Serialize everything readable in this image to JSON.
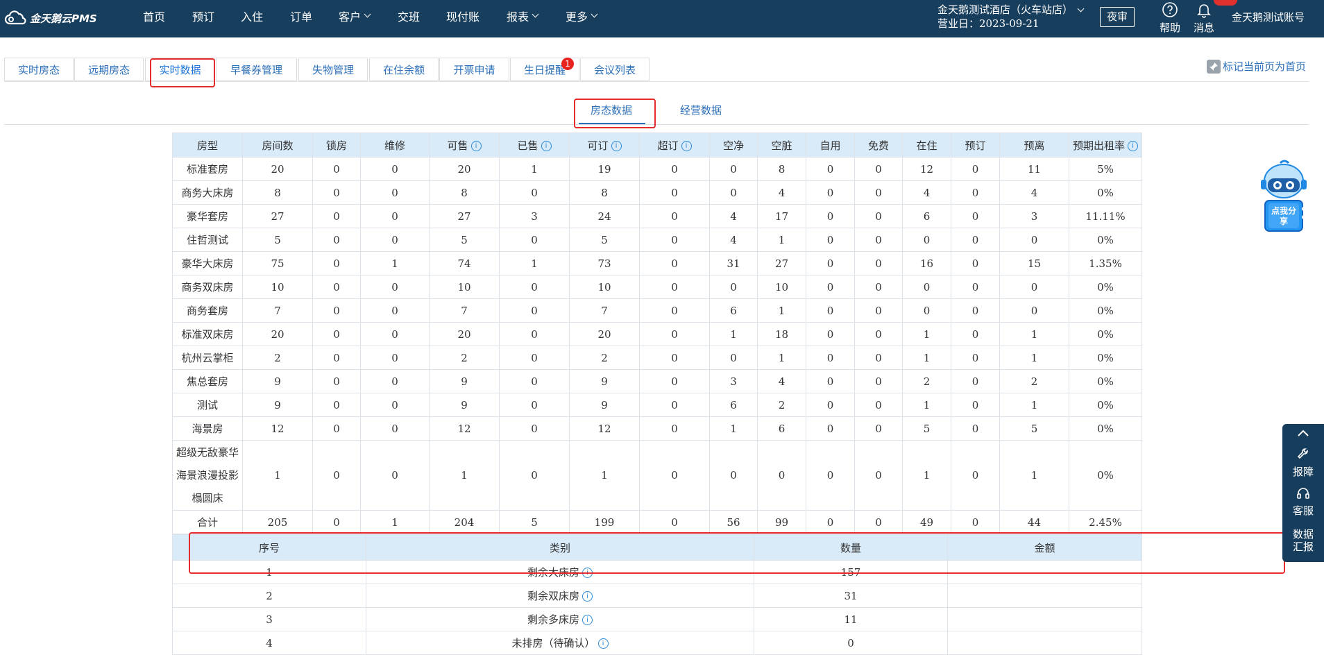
{
  "brand": {
    "name": "金天鹅云PMS"
  },
  "nav": [
    {
      "label": "首页",
      "dropdown": false
    },
    {
      "label": "预订",
      "dropdown": false
    },
    {
      "label": "入住",
      "dropdown": false
    },
    {
      "label": "订单",
      "dropdown": false
    },
    {
      "label": "客户",
      "dropdown": true
    },
    {
      "label": "交班",
      "dropdown": false
    },
    {
      "label": "现付账",
      "dropdown": false
    },
    {
      "label": "报表",
      "dropdown": true
    },
    {
      "label": "更多",
      "dropdown": true
    }
  ],
  "header": {
    "hotel_name": "金天鹅测试酒店（火车站店）",
    "business_date": "营业日：2023-09-21",
    "night_audit": "夜审",
    "help": "帮助",
    "messages": "消息",
    "account": "金天鹅测试账号"
  },
  "tabs": [
    {
      "label": "实时房态"
    },
    {
      "label": "远期房态"
    },
    {
      "label": "实时数据",
      "active": true
    },
    {
      "label": "早餐券管理"
    },
    {
      "label": "失物管理"
    },
    {
      "label": "在住余额"
    },
    {
      "label": "开票申请"
    },
    {
      "label": "生日提醒",
      "badge": "1"
    },
    {
      "label": "会议列表"
    }
  ],
  "pin_home": "标记当前页为首页",
  "subtabs": {
    "room_status": "房态数据",
    "business": "经营数据"
  },
  "room_table": {
    "headers": [
      {
        "label": "房型"
      },
      {
        "label": "房间数"
      },
      {
        "label": "锁房"
      },
      {
        "label": "维修"
      },
      {
        "label": "可售",
        "info": true
      },
      {
        "label": "已售",
        "info": true
      },
      {
        "label": "可订",
        "info": true
      },
      {
        "label": "超订",
        "info": true
      },
      {
        "label": "空净"
      },
      {
        "label": "空脏"
      },
      {
        "label": "自用"
      },
      {
        "label": "免费"
      },
      {
        "label": "在住"
      },
      {
        "label": "预订"
      },
      {
        "label": "预离"
      },
      {
        "label": "预期出租率",
        "info": true
      }
    ],
    "rows": [
      [
        "标准套房",
        "20",
        "0",
        "0",
        "20",
        "1",
        "19",
        "0",
        "0",
        "8",
        "0",
        "0",
        "12",
        "0",
        "11",
        "5%"
      ],
      [
        "商务大床房",
        "8",
        "0",
        "0",
        "8",
        "0",
        "8",
        "0",
        "0",
        "4",
        "0",
        "0",
        "4",
        "0",
        "4",
        "0%"
      ],
      [
        "豪华套房",
        "27",
        "0",
        "0",
        "27",
        "3",
        "24",
        "0",
        "4",
        "17",
        "0",
        "0",
        "6",
        "0",
        "3",
        "11.11%"
      ],
      [
        "住哲测试",
        "5",
        "0",
        "0",
        "5",
        "0",
        "5",
        "0",
        "4",
        "1",
        "0",
        "0",
        "0",
        "0",
        "0",
        "0%"
      ],
      [
        "豪华大床房",
        "75",
        "0",
        "1",
        "74",
        "1",
        "73",
        "0",
        "31",
        "27",
        "0",
        "0",
        "16",
        "0",
        "15",
        "1.35%"
      ],
      [
        "商务双床房",
        "10",
        "0",
        "0",
        "10",
        "0",
        "10",
        "0",
        "0",
        "10",
        "0",
        "0",
        "0",
        "0",
        "0",
        "0%"
      ],
      [
        "商务套房",
        "7",
        "0",
        "0",
        "7",
        "0",
        "7",
        "0",
        "6",
        "1",
        "0",
        "0",
        "0",
        "0",
        "0",
        "0%"
      ],
      [
        "标准双床房",
        "20",
        "0",
        "0",
        "20",
        "0",
        "20",
        "0",
        "1",
        "18",
        "0",
        "0",
        "1",
        "0",
        "1",
        "0%"
      ],
      [
        "杭州云掌柜",
        "2",
        "0",
        "0",
        "2",
        "0",
        "2",
        "0",
        "0",
        "1",
        "0",
        "0",
        "1",
        "0",
        "1",
        "0%"
      ],
      [
        "焦总套房",
        "9",
        "0",
        "0",
        "9",
        "0",
        "9",
        "0",
        "3",
        "4",
        "0",
        "0",
        "2",
        "0",
        "2",
        "0%"
      ],
      [
        "测试",
        "9",
        "0",
        "0",
        "9",
        "0",
        "9",
        "0",
        "6",
        "2",
        "0",
        "0",
        "1",
        "0",
        "1",
        "0%"
      ],
      [
        "海景房",
        "12",
        "0",
        "0",
        "12",
        "0",
        "12",
        "0",
        "1",
        "6",
        "0",
        "0",
        "5",
        "0",
        "5",
        "0%"
      ],
      [
        "超级无敌豪华海景浪漫投影榻圆床",
        "1",
        "0",
        "0",
        "1",
        "0",
        "1",
        "0",
        "0",
        "0",
        "0",
        "0",
        "1",
        "0",
        "1",
        "0%"
      ],
      [
        "合计",
        "205",
        "0",
        "1",
        "204",
        "5",
        "199",
        "0",
        "56",
        "99",
        "0",
        "0",
        "49",
        "0",
        "44",
        "2.45%"
      ]
    ]
  },
  "summary_table": {
    "headers": [
      {
        "label": "序号"
      },
      {
        "label": "类别"
      },
      {
        "label": "数量"
      },
      {
        "label": "金额"
      }
    ],
    "rows": [
      {
        "no": "1",
        "category": "剩余大床房",
        "info": true,
        "qty": "157",
        "amount": ""
      },
      {
        "no": "2",
        "category": "剩余双床房",
        "info": true,
        "qty": "31",
        "amount": ""
      },
      {
        "no": "3",
        "category": "剩余多床房",
        "info": true,
        "qty": "11",
        "amount": ""
      },
      {
        "no": "4",
        "category": "未排房（待确认）",
        "info": true,
        "qty": "0",
        "amount": ""
      }
    ]
  },
  "mascot": {
    "text": "点我分享"
  },
  "sidebar": {
    "report": "报障",
    "service": "客服",
    "data_summary": "数据汇报"
  }
}
